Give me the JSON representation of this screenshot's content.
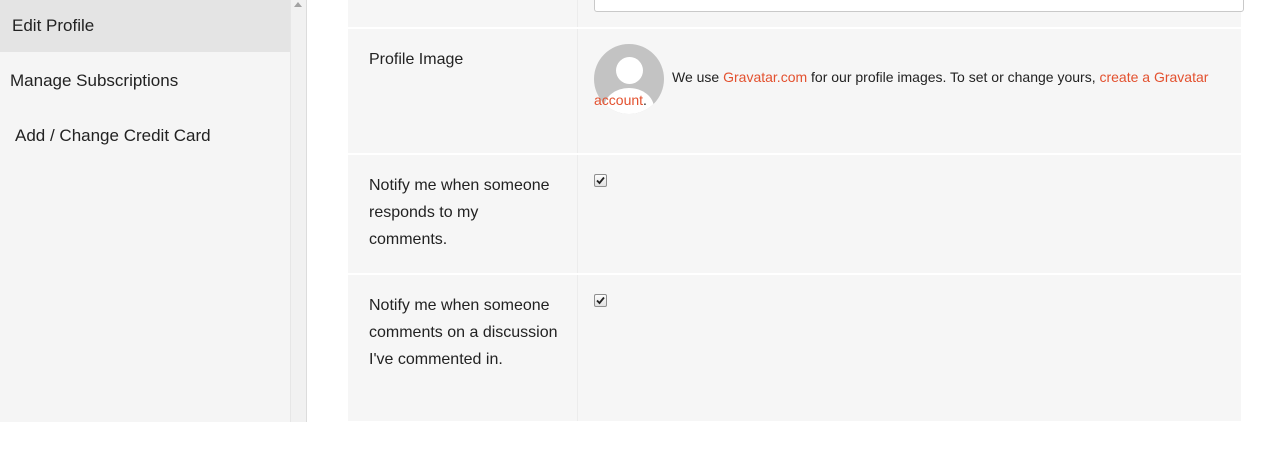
{
  "sidebar": {
    "items": [
      {
        "label": "Edit Profile",
        "active": true
      },
      {
        "label": "Manage Subscriptions"
      },
      {
        "label": "Add / Change Credit Card"
      }
    ]
  },
  "profile_image": {
    "label": "Profile Image",
    "text_before": "We use ",
    "gravatar_link": "Gravatar.com",
    "text_middle": " for our profile images. To set or change yours, ",
    "create_link": "create a Gravatar account",
    "text_after": "."
  },
  "notify_responds": {
    "label": "Notify me when someone responds to my comments.",
    "checked": true
  },
  "notify_discussion": {
    "label": "Notify me when someone comments on a discussion I've commented in.",
    "checked": true
  },
  "colors": {
    "link": "#e3512f",
    "sidebar_bg": "#f5f5f5",
    "active_item_bg": "#e4e4e4",
    "form_bg": "#f6f6f6"
  }
}
